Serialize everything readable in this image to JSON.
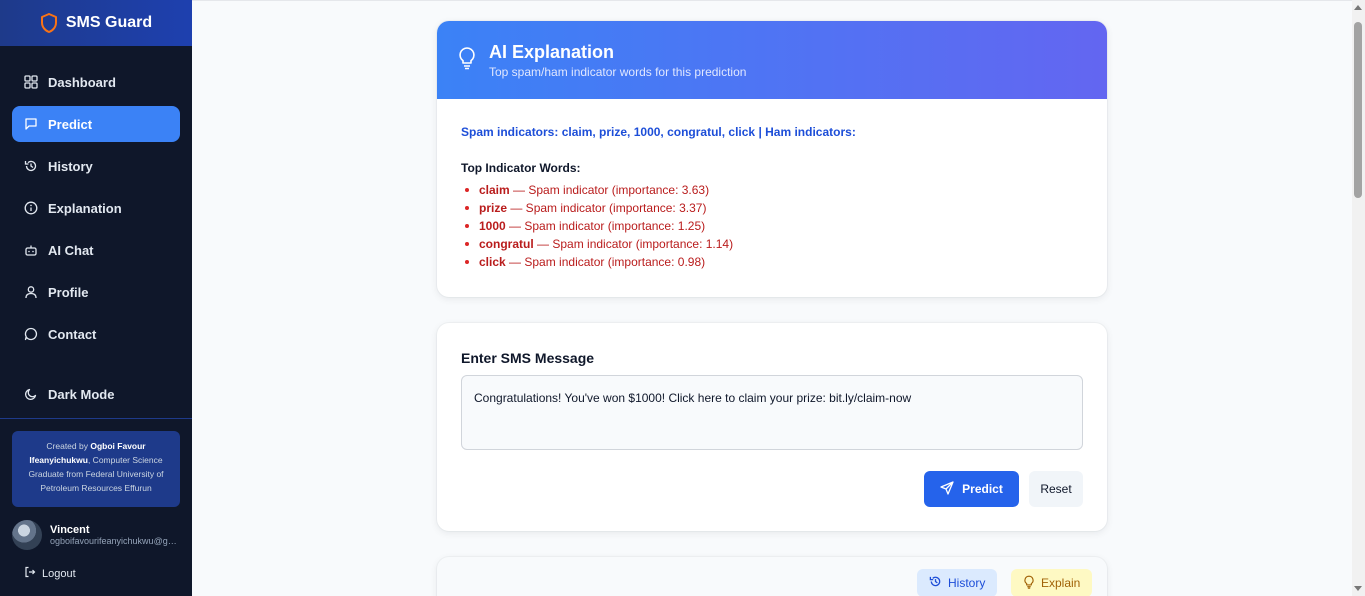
{
  "sidebar": {
    "brand": "SMS Guard",
    "nav": [
      {
        "label": "Dashboard",
        "icon": "dashboard-icon",
        "active": false
      },
      {
        "label": "Predict",
        "icon": "message-icon",
        "active": true
      },
      {
        "label": "History",
        "icon": "history-icon",
        "active": false
      },
      {
        "label": "Explanation",
        "icon": "info-icon",
        "active": false
      },
      {
        "label": "AI Chat",
        "icon": "bot-icon",
        "active": false
      },
      {
        "label": "Profile",
        "icon": "user-icon",
        "active": false
      },
      {
        "label": "Contact",
        "icon": "chat-icon",
        "active": false
      }
    ],
    "dark_mode": "Dark Mode",
    "credit": {
      "prefix": "Created by",
      "name": "Ogboi Favour Ifeanyichukwu",
      "suffix": ", Computer Science Graduate from Federal University of Petroleum Resources Effurun"
    },
    "user": {
      "name": "Vincent",
      "email": "ogboifavourifeanyichukwu@gmail.com"
    },
    "logout": "Logout"
  },
  "explanation": {
    "title": "AI Explanation",
    "subtitle": "Top spam/ham indicator words for this prediction",
    "summary": "Spam indicators: claim, prize, 1000, congratul, click | Ham indicators:",
    "heading": "Top Indicator Words:",
    "indicators": [
      {
        "word": "claim",
        "text": " — Spam indicator (importance: 3.63)"
      },
      {
        "word": "prize",
        "text": " — Spam indicator (importance: 3.37)"
      },
      {
        "word": "1000",
        "text": " — Spam indicator (importance: 1.25)"
      },
      {
        "word": "congratul",
        "text": " — Spam indicator (importance: 1.14)"
      },
      {
        "word": "click",
        "text": " — Spam indicator (importance: 0.98)"
      }
    ]
  },
  "message": {
    "label": "Enter SMS Message",
    "value": "Congratulations! You've won $1000! Click here to claim your prize: bit.ly/claim-now",
    "predict_label": "Predict",
    "reset_label": "Reset"
  },
  "actions": {
    "history_label": "History",
    "explain_label": "Explain"
  },
  "colors": {
    "sidebar_bg": "#0f172a",
    "accent": "#3b82f6",
    "spam": "#b91c1c",
    "primary_button": "#2563eb"
  }
}
